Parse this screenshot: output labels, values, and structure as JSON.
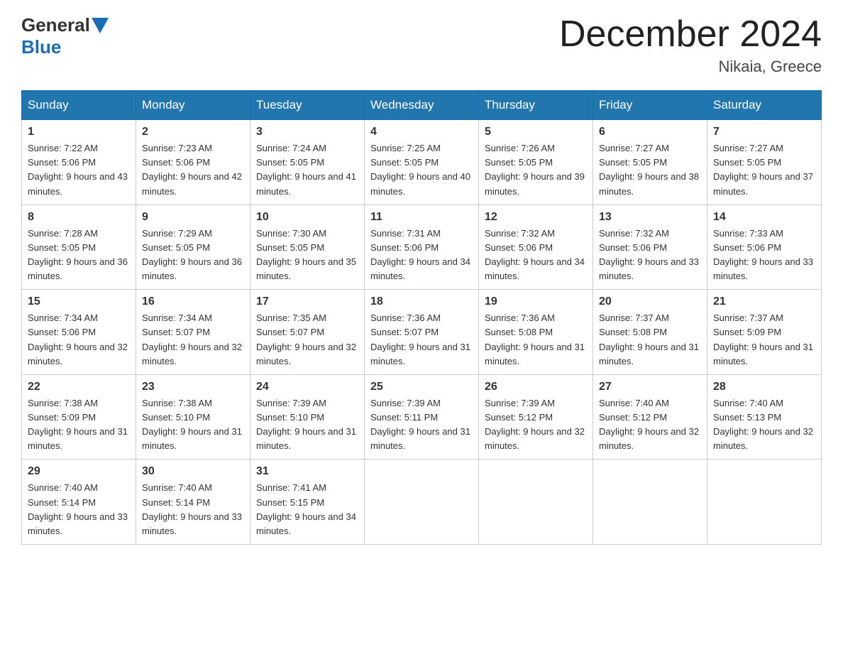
{
  "header": {
    "logo_general": "General",
    "logo_blue": "Blue",
    "month_title": "December 2024",
    "location": "Nikaia, Greece"
  },
  "weekdays": [
    "Sunday",
    "Monday",
    "Tuesday",
    "Wednesday",
    "Thursday",
    "Friday",
    "Saturday"
  ],
  "weeks": [
    [
      {
        "day": "1",
        "sunrise": "Sunrise: 7:22 AM",
        "sunset": "Sunset: 5:06 PM",
        "daylight": "Daylight: 9 hours and 43 minutes."
      },
      {
        "day": "2",
        "sunrise": "Sunrise: 7:23 AM",
        "sunset": "Sunset: 5:06 PM",
        "daylight": "Daylight: 9 hours and 42 minutes."
      },
      {
        "day": "3",
        "sunrise": "Sunrise: 7:24 AM",
        "sunset": "Sunset: 5:05 PM",
        "daylight": "Daylight: 9 hours and 41 minutes."
      },
      {
        "day": "4",
        "sunrise": "Sunrise: 7:25 AM",
        "sunset": "Sunset: 5:05 PM",
        "daylight": "Daylight: 9 hours and 40 minutes."
      },
      {
        "day": "5",
        "sunrise": "Sunrise: 7:26 AM",
        "sunset": "Sunset: 5:05 PM",
        "daylight": "Daylight: 9 hours and 39 minutes."
      },
      {
        "day": "6",
        "sunrise": "Sunrise: 7:27 AM",
        "sunset": "Sunset: 5:05 PM",
        "daylight": "Daylight: 9 hours and 38 minutes."
      },
      {
        "day": "7",
        "sunrise": "Sunrise: 7:27 AM",
        "sunset": "Sunset: 5:05 PM",
        "daylight": "Daylight: 9 hours and 37 minutes."
      }
    ],
    [
      {
        "day": "8",
        "sunrise": "Sunrise: 7:28 AM",
        "sunset": "Sunset: 5:05 PM",
        "daylight": "Daylight: 9 hours and 36 minutes."
      },
      {
        "day": "9",
        "sunrise": "Sunrise: 7:29 AM",
        "sunset": "Sunset: 5:05 PM",
        "daylight": "Daylight: 9 hours and 36 minutes."
      },
      {
        "day": "10",
        "sunrise": "Sunrise: 7:30 AM",
        "sunset": "Sunset: 5:05 PM",
        "daylight": "Daylight: 9 hours and 35 minutes."
      },
      {
        "day": "11",
        "sunrise": "Sunrise: 7:31 AM",
        "sunset": "Sunset: 5:06 PM",
        "daylight": "Daylight: 9 hours and 34 minutes."
      },
      {
        "day": "12",
        "sunrise": "Sunrise: 7:32 AM",
        "sunset": "Sunset: 5:06 PM",
        "daylight": "Daylight: 9 hours and 34 minutes."
      },
      {
        "day": "13",
        "sunrise": "Sunrise: 7:32 AM",
        "sunset": "Sunset: 5:06 PM",
        "daylight": "Daylight: 9 hours and 33 minutes."
      },
      {
        "day": "14",
        "sunrise": "Sunrise: 7:33 AM",
        "sunset": "Sunset: 5:06 PM",
        "daylight": "Daylight: 9 hours and 33 minutes."
      }
    ],
    [
      {
        "day": "15",
        "sunrise": "Sunrise: 7:34 AM",
        "sunset": "Sunset: 5:06 PM",
        "daylight": "Daylight: 9 hours and 32 minutes."
      },
      {
        "day": "16",
        "sunrise": "Sunrise: 7:34 AM",
        "sunset": "Sunset: 5:07 PM",
        "daylight": "Daylight: 9 hours and 32 minutes."
      },
      {
        "day": "17",
        "sunrise": "Sunrise: 7:35 AM",
        "sunset": "Sunset: 5:07 PM",
        "daylight": "Daylight: 9 hours and 32 minutes."
      },
      {
        "day": "18",
        "sunrise": "Sunrise: 7:36 AM",
        "sunset": "Sunset: 5:07 PM",
        "daylight": "Daylight: 9 hours and 31 minutes."
      },
      {
        "day": "19",
        "sunrise": "Sunrise: 7:36 AM",
        "sunset": "Sunset: 5:08 PM",
        "daylight": "Daylight: 9 hours and 31 minutes."
      },
      {
        "day": "20",
        "sunrise": "Sunrise: 7:37 AM",
        "sunset": "Sunset: 5:08 PM",
        "daylight": "Daylight: 9 hours and 31 minutes."
      },
      {
        "day": "21",
        "sunrise": "Sunrise: 7:37 AM",
        "sunset": "Sunset: 5:09 PM",
        "daylight": "Daylight: 9 hours and 31 minutes."
      }
    ],
    [
      {
        "day": "22",
        "sunrise": "Sunrise: 7:38 AM",
        "sunset": "Sunset: 5:09 PM",
        "daylight": "Daylight: 9 hours and 31 minutes."
      },
      {
        "day": "23",
        "sunrise": "Sunrise: 7:38 AM",
        "sunset": "Sunset: 5:10 PM",
        "daylight": "Daylight: 9 hours and 31 minutes."
      },
      {
        "day": "24",
        "sunrise": "Sunrise: 7:39 AM",
        "sunset": "Sunset: 5:10 PM",
        "daylight": "Daylight: 9 hours and 31 minutes."
      },
      {
        "day": "25",
        "sunrise": "Sunrise: 7:39 AM",
        "sunset": "Sunset: 5:11 PM",
        "daylight": "Daylight: 9 hours and 31 minutes."
      },
      {
        "day": "26",
        "sunrise": "Sunrise: 7:39 AM",
        "sunset": "Sunset: 5:12 PM",
        "daylight": "Daylight: 9 hours and 32 minutes."
      },
      {
        "day": "27",
        "sunrise": "Sunrise: 7:40 AM",
        "sunset": "Sunset: 5:12 PM",
        "daylight": "Daylight: 9 hours and 32 minutes."
      },
      {
        "day": "28",
        "sunrise": "Sunrise: 7:40 AM",
        "sunset": "Sunset: 5:13 PM",
        "daylight": "Daylight: 9 hours and 32 minutes."
      }
    ],
    [
      {
        "day": "29",
        "sunrise": "Sunrise: 7:40 AM",
        "sunset": "Sunset: 5:14 PM",
        "daylight": "Daylight: 9 hours and 33 minutes."
      },
      {
        "day": "30",
        "sunrise": "Sunrise: 7:40 AM",
        "sunset": "Sunset: 5:14 PM",
        "daylight": "Daylight: 9 hours and 33 minutes."
      },
      {
        "day": "31",
        "sunrise": "Sunrise: 7:41 AM",
        "sunset": "Sunset: 5:15 PM",
        "daylight": "Daylight: 9 hours and 34 minutes."
      },
      null,
      null,
      null,
      null
    ]
  ]
}
